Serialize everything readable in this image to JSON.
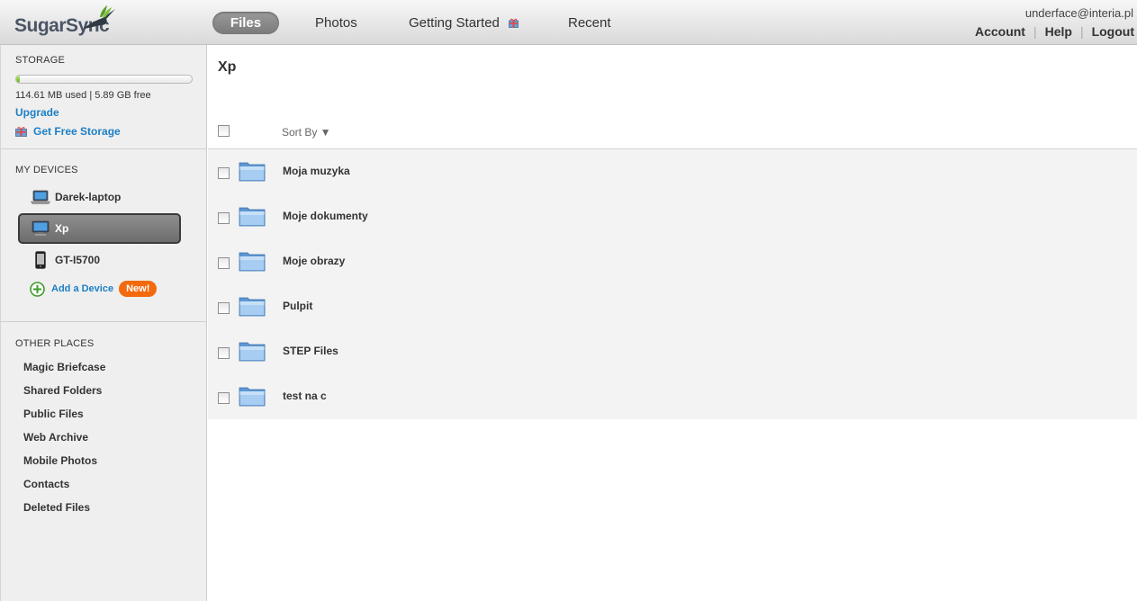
{
  "app": {
    "logo_text": "SugarSync"
  },
  "nav": {
    "tabs": [
      {
        "label": "Files"
      },
      {
        "label": "Photos"
      },
      {
        "label": "Getting Started"
      },
      {
        "label": "Recent"
      }
    ]
  },
  "user": {
    "email": "underface@interia.pl",
    "links": [
      "Account",
      "Help",
      "Logout"
    ]
  },
  "storage": {
    "title": "STORAGE",
    "used_fraction": 0.02,
    "usage_text": "114.61 MB used | 5.89 GB free",
    "upgrade_label": "Upgrade",
    "free_storage_label": "Get Free Storage"
  },
  "devices": {
    "title": "MY DEVICES",
    "items": [
      {
        "label": "Darek-laptop",
        "icon": "laptop-icon"
      },
      {
        "label": "Xp",
        "icon": "monitor-icon"
      },
      {
        "label": "GT-I5700",
        "icon": "phone-icon"
      }
    ],
    "add_label": "Add a Device",
    "new_badge": "New!"
  },
  "other_places": {
    "title": "OTHER PLACES",
    "items": [
      "Magic Briefcase",
      "Shared Folders",
      "Public Files",
      "Web Archive",
      "Mobile Photos",
      "Contacts",
      "Deleted Files"
    ]
  },
  "main": {
    "title": "Xp",
    "sort_label": "Sort By ▼",
    "files": [
      "Moja muzyka",
      "Moje dokumenty",
      "Moje obrazy",
      "Pulpit",
      "STEP Files",
      "test na c"
    ]
  },
  "colors": {
    "link_blue": "#1c7fc4",
    "badge_orange": "#f26a0d",
    "storage_green": "#6db12a",
    "folder_blue": "#7fb4e8"
  }
}
